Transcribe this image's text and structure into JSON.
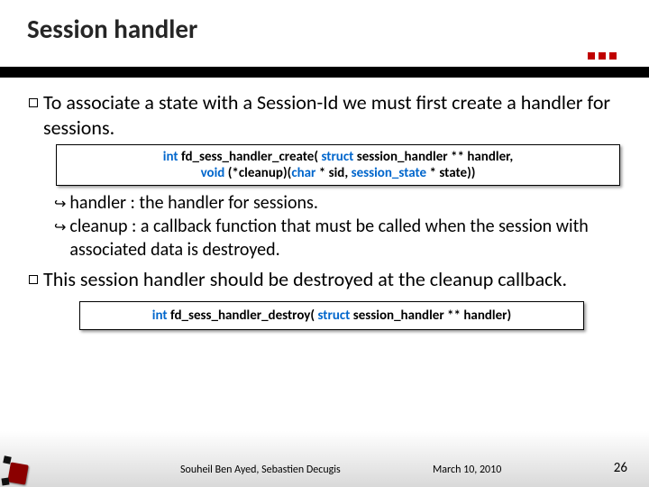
{
  "title": "Session handler",
  "bullets": {
    "b1": "To associate a state with a Session-Id we must first create a handler for sessions.",
    "b2": "This session handler should be destroyed at the cleanup callback."
  },
  "sub": {
    "handler": "handler : the handler for sessions.",
    "cleanup": "cleanup : a callback function that must be called when the session with associated data is destroyed."
  },
  "code1": {
    "ret": "int",
    "fn": "fd_sess_handler_create(",
    "kw1": "struct",
    "arg1": "session_handler ** handler,",
    "line2a": "void",
    "line2b": "(*cleanup)(",
    "line2c": "char",
    "line2d": " * sid, ",
    "line2e": "session_state",
    "line2f": " * state))"
  },
  "code2": {
    "ret": "int",
    "fn": "fd_sess_handler_destroy(",
    "kw1": "struct",
    "arg1": "session_handler ** handler)"
  },
  "footer": {
    "author": "Souheil Ben Ayed, Sebastien Decugis",
    "date": "March 10, 2010",
    "page": "26"
  }
}
